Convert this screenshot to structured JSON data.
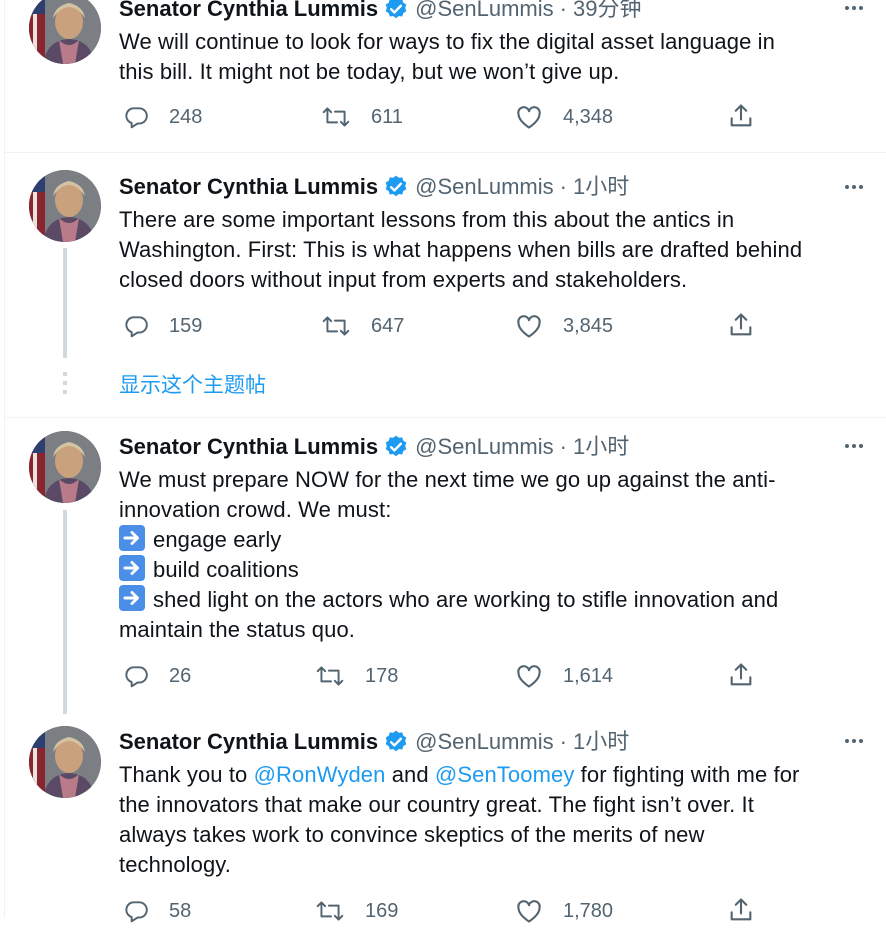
{
  "colors": {
    "link": "#1d9bf0",
    "secondary_text": "#536471",
    "primary_text": "#0f1419",
    "thread_line": "#cfd9de",
    "divider": "#eff3f4"
  },
  "icons": {
    "verified": "verified-badge-icon",
    "more": "more-dots-icon",
    "reply": "reply-bubble-icon",
    "retweet": "retweet-icon",
    "like": "heart-icon",
    "share": "share-icon",
    "bullet": "right-arrow-emoji-icon"
  },
  "show_thread": "显示这个主题帖",
  "tweets": [
    {
      "name": "Senator Cynthia Lummis",
      "handle": "@SenLummis",
      "sep": "·",
      "time": "39分钟",
      "lines": [
        "We will continue to look for ways to fix the digital asset language in",
        "this bill. It might not be today, but we won’t give up."
      ],
      "replies": "248",
      "retweets": "611",
      "likes": "4,348"
    },
    {
      "name": "Senator Cynthia Lummis",
      "handle": "@SenLummis",
      "sep": "·",
      "time": "1小时",
      "lines": [
        "There are some important lessons from this about the antics in",
        "Washington. First: This is what happens when bills are drafted behind",
        "closed doors without input from experts and stakeholders."
      ],
      "replies": "159",
      "retweets": "647",
      "likes": "3,845"
    },
    {
      "name": "Senator Cynthia Lummis",
      "handle": "@SenLummis",
      "sep": "·",
      "time": "1小时",
      "lines": [
        "We must prepare NOW for the next time we go up against the anti-",
        "innovation crowd. We must:"
      ],
      "bullets": [
        "engage early",
        "build coalitions",
        "shed light on the actors who are working to stifle innovation and"
      ],
      "tail": "maintain the status quo.",
      "replies": "26",
      "retweets": "178",
      "likes": "1,614"
    },
    {
      "name": "Senator Cynthia Lummis",
      "handle": "@SenLummis",
      "sep": "·",
      "time": "1小时",
      "line1_a": "Thank you to ",
      "mention1": "@RonWyden",
      "line1_b": " and ",
      "mention2": "@SenToomey",
      "line1_c": " for fighting with me for",
      "lines": [
        "the innovators that make our country great. The fight isn’t over. It",
        "always takes work to convince skeptics of the merits of new",
        "technology."
      ],
      "replies": "58",
      "retweets": "169",
      "likes": "1,780"
    }
  ]
}
